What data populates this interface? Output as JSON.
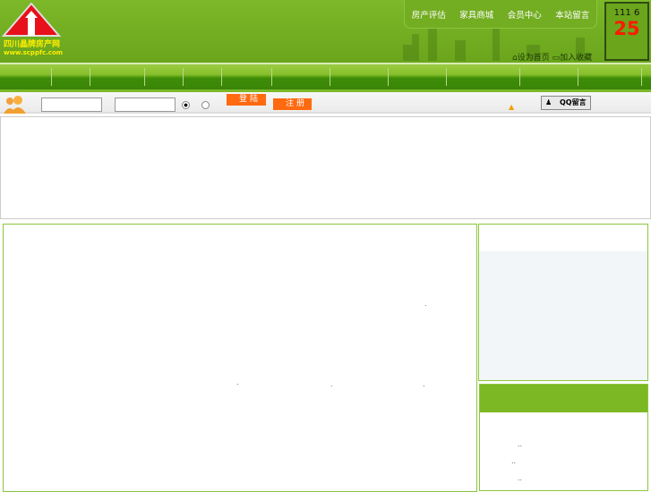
{
  "logo": {
    "name_cn": "四川晶牌房产网",
    "url": "www.scppfc.com"
  },
  "top_nav": [
    "房产评估",
    "家具商城",
    "会员中心",
    "本站留言"
  ],
  "quick_links": {
    "set_home": "设为首页",
    "bookmark": "加入收藏"
  },
  "date_box": {
    "line1": "111 6",
    "day": "25"
  },
  "login": {
    "login_button": "登陆",
    "register_button": "注册",
    "qq_button": "QQ留言"
  },
  "content_marks": [
    ".",
    ".",
    ".",
    ".",
    "..",
    "..",
    ".."
  ]
}
